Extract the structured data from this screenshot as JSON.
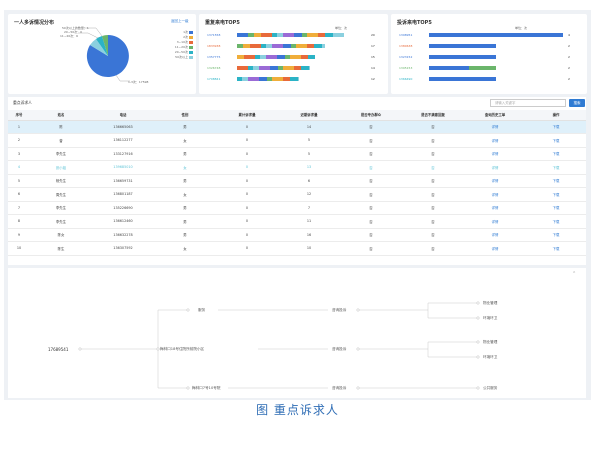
{
  "pie_card": {
    "title": "一人多诉情况分布",
    "link": "返回上一级",
    "legend": [
      "1次",
      "2次",
      "3~10次",
      "11~20次",
      "20~50次",
      "50次以上"
    ],
    "labels": {
      "top": "50次以上的数量：1",
      "mid1": "20~50次：0",
      "mid2": "11~20次：6",
      "bottom": "1-3次：17598"
    },
    "colors": [
      "#3a75d6",
      "#f0ae3a",
      "#e86a3a",
      "#6bb56b",
      "#2bb3c6",
      "#8bd0df"
    ]
  },
  "phone_card": {
    "title": "重复来电TOP5",
    "unit": "单位：次",
    "rows": [
      {
        "label": "1371558",
        "value": "20"
      },
      {
        "label": "1833938",
        "value": "17"
      },
      {
        "label": "1357775",
        "value": "15"
      },
      {
        "label": "1326748",
        "value": "14"
      },
      {
        "label": "1708841",
        "value": "12"
      }
    ],
    "bar_fraction": [
      0.82,
      0.68,
      0.6,
      0.56,
      0.48
    ]
  },
  "address_card": {
    "title": "投诉来电TOP5",
    "unit": "单位：次",
    "rows": [
      {
        "label": "1398951",
        "value": "4"
      },
      {
        "label": "1380638",
        "value": "2"
      },
      {
        "label": "1323152",
        "value": "2"
      },
      {
        "label": "1395153",
        "value": "2"
      },
      {
        "label": "1366490",
        "value": "2"
      }
    ],
    "bar_fraction": [
      1.0,
      0.5,
      0.5,
      0.5,
      0.5
    ]
  },
  "table": {
    "caption": "重点诉求人",
    "search_placeholder": "请输入关键字",
    "search_button": "搜索",
    "headers": [
      "序号",
      "姓名",
      "电话",
      "性别",
      "累计诉求量",
      "近期诉求量",
      "是否专办群众",
      "是否不满意回复",
      "查询历史工单",
      "操作"
    ],
    "rows": [
      [
        "1",
        "陈",
        "136665063",
        "男",
        "0",
        "14",
        "否",
        "否",
        "详情",
        "下载"
      ],
      [
        "2",
        "曾",
        "136112277",
        "女",
        "0",
        "5",
        "否",
        "否",
        "详情",
        "下载"
      ],
      [
        "3",
        "李先生",
        "133127916",
        "男",
        "0",
        "5",
        "否",
        "否",
        "详情",
        "下载"
      ],
      [
        "4",
        "张小姐",
        "139685010",
        "女",
        "0",
        "13",
        "否",
        "否",
        "详情",
        "下载"
      ],
      [
        "5",
        "杨先生",
        "136659731",
        "男",
        "0",
        "6",
        "否",
        "否",
        "详情",
        "下载"
      ],
      [
        "6",
        "周先生",
        "136801187",
        "女",
        "0",
        "12",
        "否",
        "否",
        "详情",
        "下载"
      ],
      [
        "7",
        "李先生",
        "135226690",
        "男",
        "0",
        "7",
        "否",
        "否",
        "详情",
        "下载"
      ],
      [
        "8",
        "李先生",
        "136612460",
        "男",
        "0",
        "11",
        "否",
        "否",
        "详情",
        "下载"
      ],
      [
        "9",
        "陈女",
        "136632278",
        "男",
        "0",
        "16",
        "否",
        "否",
        "详情",
        "下载"
      ],
      [
        "10",
        "陈生",
        "136307592",
        "女",
        "0",
        "10",
        "否",
        "否",
        "详情",
        "下载"
      ]
    ]
  },
  "tree": {
    "collapse_icon": "⌃",
    "root": "17689541",
    "branch_a": "服务",
    "branch_b": "梅林口18号住院所前院小区",
    "branch_c": "梅林口7号10号院",
    "mid_a": "咨询投诉",
    "mid_b": "咨询投诉",
    "mid_c": "咨询投诉",
    "leaf_a1": "物业管理",
    "leaf_a2": "环境环卫",
    "leaf_b1": "物业管理",
    "leaf_b2": "环境环卫",
    "leaf_c1": "公共服务"
  },
  "figure_caption": "图 重点诉求人"
}
